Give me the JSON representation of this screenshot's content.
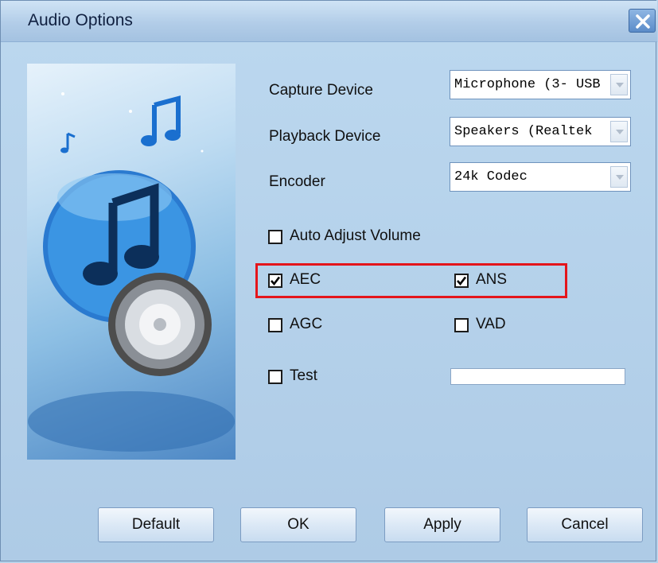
{
  "window": {
    "title": "Audio Options"
  },
  "fields": {
    "capture_label": "Capture Device",
    "capture_value": "Microphone (3- USB",
    "playback_label": "Playback Device",
    "playback_value": "Speakers (Realtek",
    "encoder_label": "Encoder",
    "encoder_value": "24k Codec"
  },
  "options": {
    "auto_adjust": {
      "label": "Auto Adjust Volume",
      "checked": false
    },
    "aec": {
      "label": "AEC",
      "checked": true
    },
    "ans": {
      "label": "ANS",
      "checked": true
    },
    "agc": {
      "label": "AGC",
      "checked": false
    },
    "vad": {
      "label": "VAD",
      "checked": false
    },
    "test": {
      "label": "Test",
      "checked": false
    }
  },
  "test_level": 0,
  "buttons": {
    "default": "Default",
    "ok": "OK",
    "apply": "Apply",
    "cancel": "Cancel"
  },
  "colors": {
    "highlight": "#e4151b",
    "titlebar": "#b2cde8",
    "background": "#b6d2ea"
  }
}
